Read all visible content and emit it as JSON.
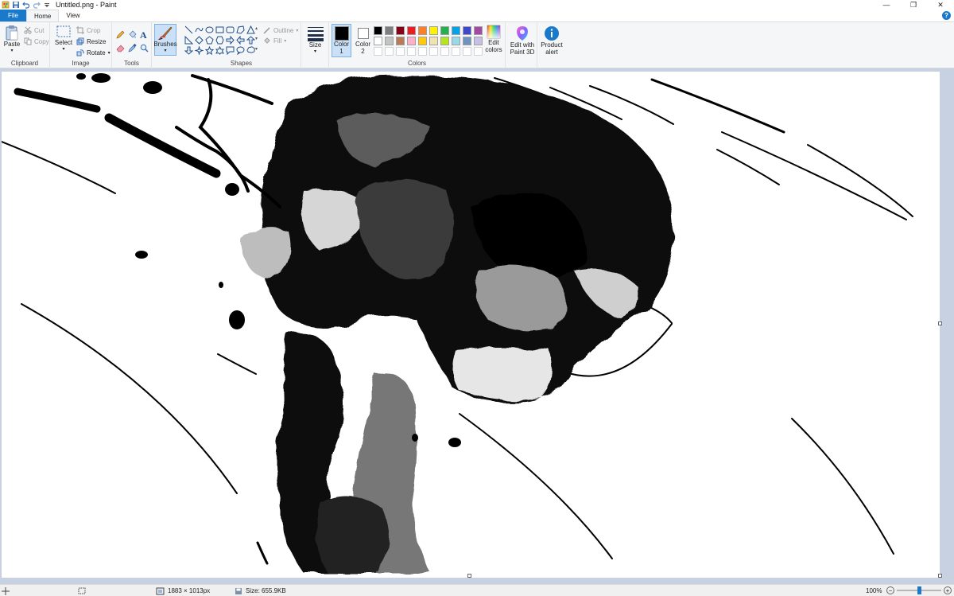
{
  "window": {
    "title": "Untitled.png - Paint",
    "minimize": "—",
    "restore": "❐",
    "close": "✕"
  },
  "tabs": [
    {
      "label": "File"
    },
    {
      "label": "Home"
    },
    {
      "label": "View"
    }
  ],
  "help_label": "?",
  "ribbon": {
    "clipboard": {
      "label": "Clipboard",
      "paste": "Paste",
      "cut": "Cut",
      "copy": "Copy"
    },
    "image": {
      "label": "Image",
      "select": "Select",
      "crop": "Crop",
      "resize": "Resize",
      "rotate": "Rotate"
    },
    "tools": {
      "label": "Tools",
      "text_tool": "A"
    },
    "brushes": {
      "label": "Brushes"
    },
    "shapes": {
      "label": "Shapes",
      "outline": "Outline",
      "fill": "Fill"
    },
    "size": {
      "label": "Size"
    },
    "colors": {
      "label": "Colors",
      "color1": "Color 1",
      "color2": "Color 2",
      "edit_colors": "Edit colors",
      "color1_value": "#000000",
      "color2_value": "#ffffff",
      "palette_row1": [
        "#000000",
        "#7f7f7f",
        "#880015",
        "#ed1c24",
        "#ff7f27",
        "#fff200",
        "#22b14c",
        "#00a2e8",
        "#3f48cc",
        "#a349a4"
      ],
      "palette_row2": [
        "#ffffff",
        "#c3c3c3",
        "#b97a57",
        "#ffaec9",
        "#ffc90e",
        "#efe4b0",
        "#b5e61d",
        "#99d9ea",
        "#7092be",
        "#c8bfe7"
      ]
    },
    "paint3d": {
      "label": "Edit with Paint 3D"
    },
    "product_alert": {
      "label": "Product alert"
    }
  },
  "status": {
    "dimensions": "1883 × 1013px",
    "size": "Size: 655.9KB",
    "zoom": "100%",
    "zoom_fraction": 0.5
  }
}
